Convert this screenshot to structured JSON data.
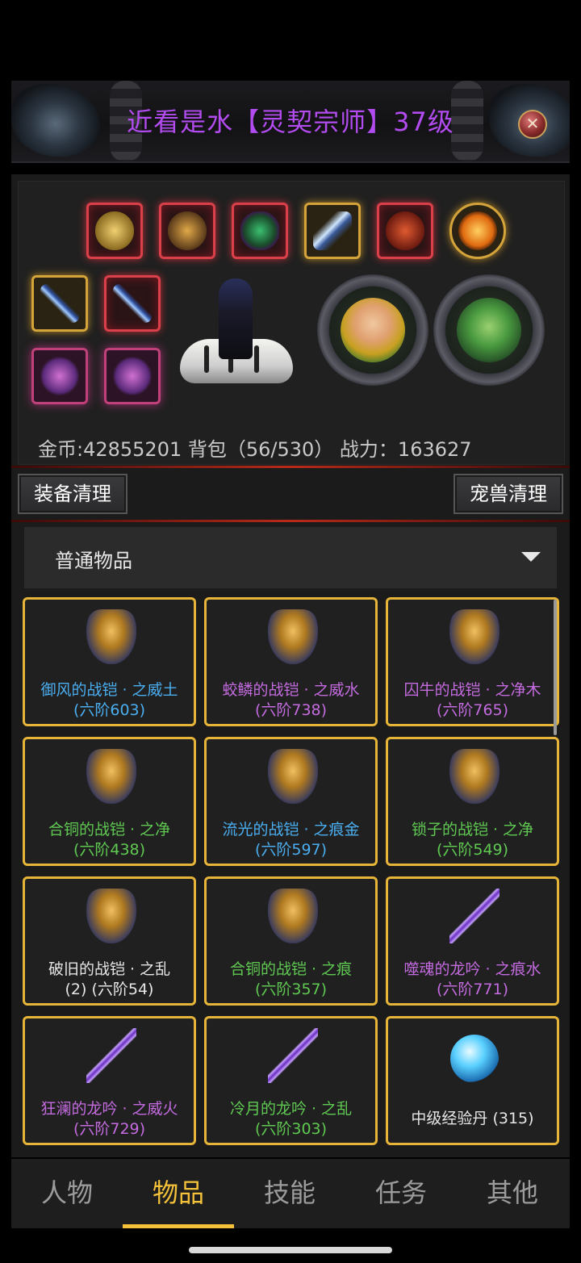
{
  "header": {
    "title": "近看是水【灵契宗师】37级",
    "close_icon": "close-icon"
  },
  "stats": {
    "text": "金币:42855201 背包（56/530） 战力：163627"
  },
  "actions": {
    "equip_clean": "装备清理",
    "pet_clean": "宠兽清理"
  },
  "filter": {
    "selected": "普通物品"
  },
  "items": [
    {
      "name": "御风的战铠 · 之威土",
      "sub": "(六阶603)",
      "color": "blue",
      "icon": "armor-icon"
    },
    {
      "name": "蛟鳞的战铠 · 之威水",
      "sub": "(六阶738)",
      "color": "purple",
      "icon": "armor-icon"
    },
    {
      "name": "囚牛的战铠 · 之净木",
      "sub": "(六阶765)",
      "color": "purple",
      "icon": "armor-icon"
    },
    {
      "name": "合铜的战铠 · 之净",
      "sub": "(六阶438)",
      "color": "green",
      "icon": "armor-icon"
    },
    {
      "name": "流光的战铠 · 之痕金",
      "sub": "(六阶597)",
      "color": "blue",
      "icon": "armor-icon"
    },
    {
      "name": "锁子的战铠 · 之净",
      "sub": "(六阶549)",
      "color": "green",
      "icon": "armor-icon"
    },
    {
      "name": "破旧的战铠 · 之乱",
      "sub": "(2) (六阶54)",
      "color": "white",
      "icon": "armor-icon"
    },
    {
      "name": "合铜的战铠 · 之痕",
      "sub": "(六阶357)",
      "color": "green",
      "icon": "armor-icon"
    },
    {
      "name": "噬魂的龙吟 · 之痕水",
      "sub": "(六阶771)",
      "color": "purple",
      "icon": "spear-icon"
    },
    {
      "name": "狂澜的龙吟 · 之威火",
      "sub": "(六阶729)",
      "color": "purple",
      "icon": "spear-icon"
    },
    {
      "name": "冷月的龙吟 · 之乱",
      "sub": "(六阶303)",
      "color": "green",
      "icon": "spear-icon"
    },
    {
      "name": "中级经验丹 (315)",
      "sub": "",
      "color": "white",
      "icon": "exp-orb-icon"
    }
  ],
  "tabs": [
    {
      "label": "人物",
      "active": false
    },
    {
      "label": "物品",
      "active": true
    },
    {
      "label": "技能",
      "active": false
    },
    {
      "label": "任务",
      "active": false
    },
    {
      "label": "其他",
      "active": false
    }
  ],
  "colors": {
    "accent": "#f3c23a",
    "item_border": "#e7b43a",
    "title": "#b24cf0",
    "blue": "#4aaef0",
    "purple": "#c46be0",
    "green": "#5fc952",
    "white": "#e6e6e6"
  }
}
